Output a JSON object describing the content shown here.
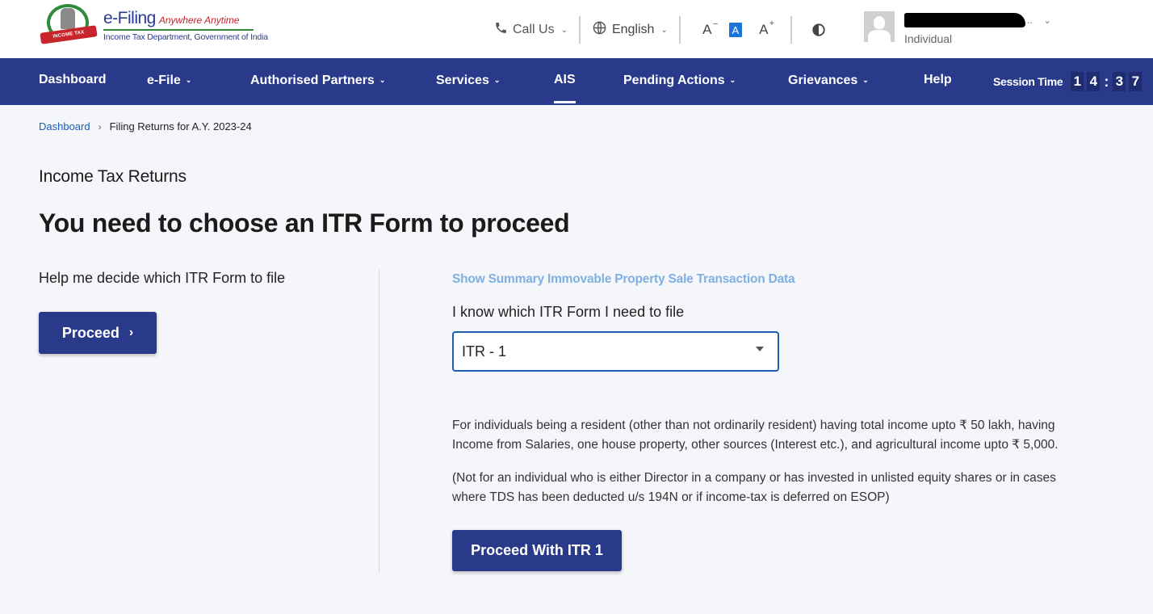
{
  "header": {
    "logo": {
      "emblem_ribbon": "INCOME TAX DEPARTMENT",
      "title": "e-Filing",
      "tagline": "Anywhere Anytime",
      "subtitle": "Income Tax Department, Government of India"
    },
    "call_us": "Call Us",
    "language": "English",
    "font_decrease": "A",
    "font_default": "A",
    "font_increase": "A",
    "user": {
      "name_suffix": "..",
      "role": "Individual"
    }
  },
  "nav": {
    "items": [
      {
        "label": "Dashboard",
        "has_dropdown": false
      },
      {
        "label": "e-File",
        "has_dropdown": true
      },
      {
        "label": "Authorised Partners",
        "has_dropdown": true
      },
      {
        "label": "Services",
        "has_dropdown": true
      },
      {
        "label": "AIS",
        "has_dropdown": false,
        "active": true
      },
      {
        "label": "Pending Actions",
        "has_dropdown": true
      },
      {
        "label": "Grievances",
        "has_dropdown": true
      },
      {
        "label": "Help",
        "has_dropdown": false
      }
    ],
    "session": {
      "label": "Session Time",
      "digits": [
        "1",
        "4",
        "3",
        "7"
      ],
      "separator": ":"
    }
  },
  "breadcrumb": {
    "home": "Dashboard",
    "current": "Filing Returns for A.Y. 2023-24"
  },
  "main": {
    "section_label": "Income Tax Returns",
    "title": "You need to choose an ITR Form to proceed",
    "left": {
      "help_text": "Help me decide which ITR Form to file",
      "proceed_button": "Proceed"
    },
    "right": {
      "summary_link": "Show Summary Immovable Property Sale Transaction Data",
      "know_label": "I know which ITR Form I need to file",
      "selected_form": "ITR - 1",
      "description": "For individuals being a resident (other than not ordinarily resident) having total income upto ₹ 50 lakh, having Income from Salaries, one house property, other sources (Interest etc.), and agricultural income upto ₹ 5,000.",
      "note": "(Not for an individual who is either Director in a company or has invested in unlisted equity shares or in cases where TDS has been deducted u/s 194N or if income-tax is deferred on ESOP)",
      "proceed_itr_button": "Proceed With ITR 1"
    }
  },
  "colors": {
    "primary": "#2a3a8b",
    "link": "#1a5fb4",
    "summary_link": "#7fb0e0",
    "accent_red": "#c8242b",
    "accent_green": "#2f8a3a"
  }
}
